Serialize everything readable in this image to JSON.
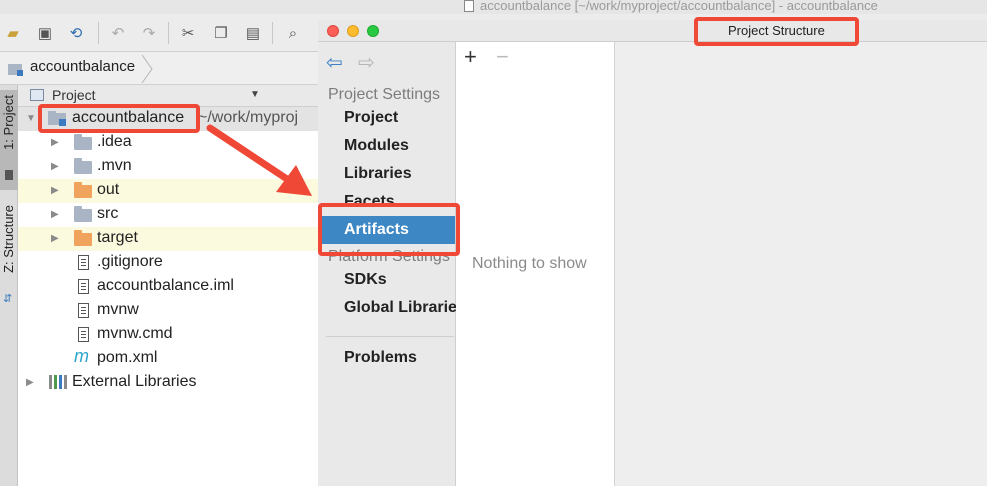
{
  "ide": {
    "window_title": "accountbalance [~/work/myproject/accountbalance] - accountbalance",
    "breadcrumb": "accountbalance",
    "tool_tabs": [
      "1: Project",
      "Z: Structure"
    ]
  },
  "toolbar": {
    "icons": [
      "open-icon",
      "save-icon",
      "sync-icon",
      "undo-icon",
      "redo-icon",
      "cut-icon",
      "copy-icon",
      "paste-icon",
      "search-icon"
    ]
  },
  "project_panel": {
    "view_label": "Project",
    "root": {
      "name": "accountbalance",
      "path": "~/work/myproj"
    },
    "items": [
      {
        "label": ".idea"
      },
      {
        "label": ".mvn"
      },
      {
        "label": "out"
      },
      {
        "label": "src"
      },
      {
        "label": "target"
      },
      {
        "label": ".gitignore"
      },
      {
        "label": "accountbalance.iml"
      },
      {
        "label": "mvnw"
      },
      {
        "label": "mvnw.cmd"
      },
      {
        "label": "pom.xml",
        "icon_text": "m"
      },
      {
        "label": "External Libraries"
      }
    ]
  },
  "dialog": {
    "title": "Project Structure",
    "sections": [
      {
        "label": "Project Settings",
        "items": [
          "Project",
          "Modules",
          "Libraries",
          "Facets",
          "Artifacts"
        ]
      },
      {
        "label": "Platform Settings",
        "items": [
          "SDKs",
          "Global Libraries"
        ]
      }
    ],
    "problems_label": "Problems",
    "selected_item": "Artifacts",
    "empty_text": "Nothing to show",
    "add_label": "+",
    "remove_label": "−"
  },
  "colors": {
    "annotation": "#ef4836",
    "selection": "#3d87c4",
    "folder": "#a9b5c4",
    "excluded_folder": "#f0a35d"
  }
}
